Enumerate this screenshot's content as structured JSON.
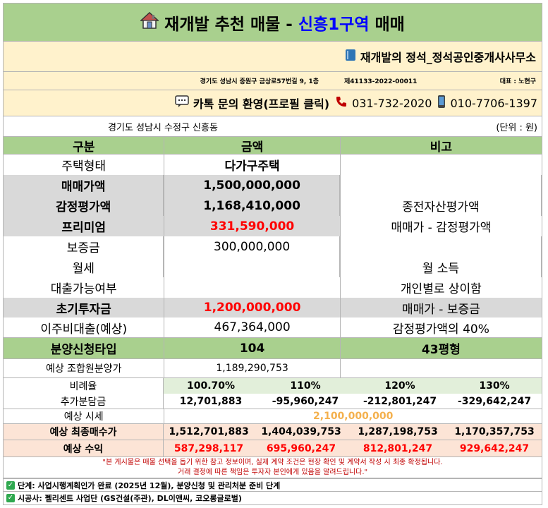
{
  "title": {
    "prefix": "재개발 추천 매물 -",
    "accent": "신흥1구역",
    "suffix": "매매",
    "icon": "house-icon"
  },
  "office": {
    "name": "재개발의 정석_정석공인중개사사무소",
    "icon": "book-icon"
  },
  "address_line": {
    "address": "경기도 성남시 중원구 금상로57번길 9, 1층",
    "registration": "제41133-2022-00011",
    "representative": "대표 : 노현구"
  },
  "contact": {
    "kakao": "카톡 문의 환영(프로필 클릭)",
    "phone1": "031-732-2020",
    "phone2": "010-7706-1397"
  },
  "location": {
    "area": "경기도 성남시 수정구 신흥동",
    "unit": "(단위 : 원)"
  },
  "table": {
    "headers": [
      "구분",
      "금액",
      "비고"
    ],
    "rows": [
      {
        "label": "주택형태",
        "value": "다가구주택",
        "note": ""
      },
      {
        "label": "매매가액",
        "value": "1,500,000,000",
        "note": ""
      },
      {
        "label": "감정평가액",
        "value": "1,168,410,000",
        "note": "종전자산평가액"
      },
      {
        "label": "프리미엄",
        "value": "331,590,000",
        "note": "매매가 - 감정평가액"
      },
      {
        "label": "보증금",
        "value": "300,000,000",
        "note": ""
      },
      {
        "label": "월세",
        "value": "",
        "note": "월 소득"
      },
      {
        "label": "대출가능여부",
        "value": "",
        "note": "개인별로 상이함"
      },
      {
        "label": "초기투자금",
        "value": "1,200,000,000",
        "note": "매매가 - 보증금"
      },
      {
        "label": "이주비대출(예상)",
        "value": "467,364,000",
        "note": "감정평가액의 40%"
      }
    ]
  },
  "application": {
    "label": "분양신청타입",
    "type": "104",
    "size": "43평형"
  },
  "member_price": {
    "label": "예상 조합원분양가",
    "value": "1,189,290,753"
  },
  "ratio": {
    "label": "비례율",
    "values": [
      "100.70%",
      "110%",
      "120%",
      "130%"
    ]
  },
  "additional": {
    "label": "추가분담금",
    "values": [
      "12,701,883",
      "-95,960,247",
      "-212,801,247",
      "-329,642,247"
    ]
  },
  "market": {
    "label": "예상 시세",
    "value": "2,100,000,000"
  },
  "final_cost": {
    "label": "예상 최종매수가",
    "values": [
      "1,512,701,883",
      "1,404,039,753",
      "1,287,198,753",
      "1,170,357,753"
    ]
  },
  "profit": {
    "label": "예상 수익",
    "values": [
      "587,298,117",
      "695,960,247",
      "812,801,247",
      "929,642,247"
    ]
  },
  "notice": {
    "line1": "\"본 게시물은 매물 선택을 돕기 위한 참고 정보이며, 실제 계약 조건은 현장 확인 및 계약서 작성 시 최종 확정됩니다.",
    "line2": "거래 결정에 따른 책임은 투자자 본인에게 있음을 알려드립니다.\""
  },
  "stage": "단계: 사업시행계획인가 완료 (2025년 12월), 분양신청 및 관리처분 준비 단계",
  "builder": "시공사: 펠리센트 사업단 (GS건설(주관), DL이앤씨, 코오롱글로벌)",
  "colors": {
    "header_green": "#a9d08e",
    "cream": "#fff2cc",
    "gray": "#d9d9d9",
    "red": "#ff0000",
    "orange": "#f4b04c",
    "pink": "#fce4d6",
    "accent_blue": "#0000ff"
  }
}
